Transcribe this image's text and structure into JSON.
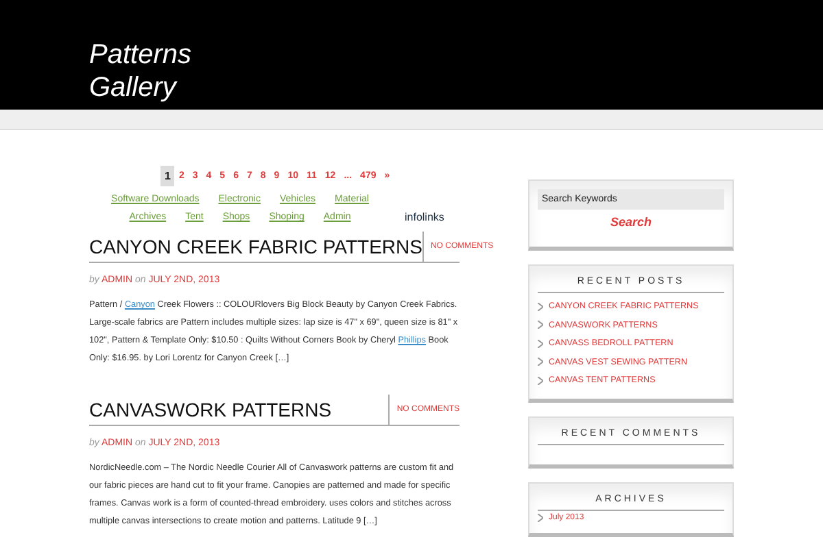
{
  "site": {
    "title_lines": [
      "Patterns",
      "Gallery"
    ]
  },
  "pagination": [
    {
      "label": "1",
      "selected": true
    },
    {
      "label": "2",
      "selected": false
    },
    {
      "label": "3",
      "selected": false
    },
    {
      "label": "4",
      "selected": false
    },
    {
      "label": "5",
      "selected": false
    },
    {
      "label": "6",
      "selected": false
    },
    {
      "label": "7",
      "selected": false
    },
    {
      "label": "8",
      "selected": false
    },
    {
      "label": "9",
      "selected": false
    },
    {
      "label": "10",
      "selected": false
    },
    {
      "label": "11",
      "selected": false
    },
    {
      "label": "12",
      "selected": false
    },
    {
      "label": "...",
      "selected": false
    },
    {
      "label": "479",
      "selected": false
    },
    {
      "label": "»",
      "selected": false
    }
  ],
  "ad_links": [
    [
      "Software Downloads",
      "Electronic",
      "Vehicles",
      "Material"
    ],
    [
      "Archives",
      "Tent",
      "Shops",
      "Shoping",
      "Admin"
    ]
  ],
  "ad_brand": "infolinks",
  "posts": [
    {
      "title": "CANYON CREEK FABRIC PATTERNS",
      "comments": "NO COMMENTS",
      "by": "by",
      "author": "ADMIN",
      "on": "on",
      "date": "JULY 2ND, 2013",
      "excerpt": [
        {
          "text": "Pattern / ",
          "link": false
        },
        {
          "text": "Canyon",
          "link": true
        },
        {
          "text": " Creek Flowers :: COLOURlovers Big Block Beauty by Canyon Creek Fabrics. Large-scale fabrics are Pattern includes multiple sizes: lap size is 47\" x 69\", queen size is 81\" x 102\", Pattern & Template Only: $10.50 : Quilts Without Corners Book by Cheryl ",
          "link": false
        },
        {
          "text": "Phillips",
          "link": true
        },
        {
          "text": " Book Only: $16.95. by Lori Lorentz for Canyon Creek […]",
          "link": false
        }
      ]
    },
    {
      "title": "CANVASWORK PATTERNS",
      "comments": "NO COMMENTS",
      "by": "by",
      "author": "ADMIN",
      "on": "on",
      "date": "JULY 2ND, 2013",
      "excerpt": [
        {
          "text": "NordicNeedle.com – The Nordic Needle Courier All of Canvaswork patterns are custom fit and our fabric pieces are hand cut to fit your frame. Canopies are patterned and made for specific frames. Canvas work is a form of counted-thread embroidery. uses colors and stitches across multiple canvas intersections to create motion and patterns. Latitude 9 […]",
          "link": false
        }
      ]
    }
  ],
  "search": {
    "placeholder": "Search Keywords",
    "button": "Search"
  },
  "widgets": [
    {
      "title": "RECENT POSTS",
      "items": [
        "CANYON CREEK FABRIC PATTERNS",
        "CANVASWORK PATTERNS",
        "CANVASS BEDROLL PATTERN",
        "CANVAS VEST SEWING PATTERN",
        "CANVAS TENT PATTERNS"
      ],
      "kind": "caps"
    },
    {
      "title": "RECENT COMMENTS",
      "kind": "caps"
    },
    {
      "title": "ARCHIVES",
      "items": [
        "July 2013"
      ],
      "kind": "plain"
    }
  ]
}
